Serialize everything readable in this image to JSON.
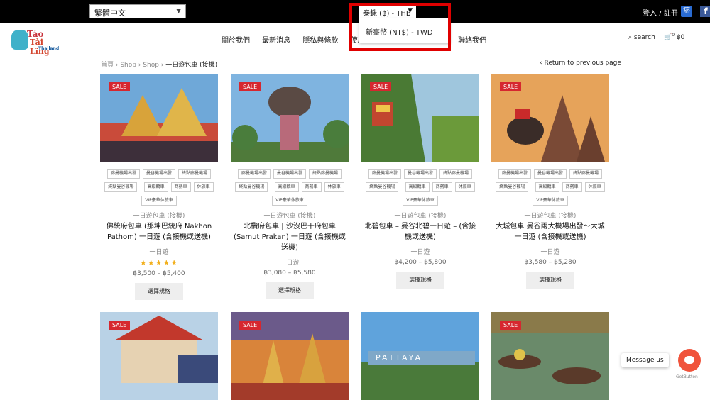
{
  "topbar": {
    "language": "繁體中文",
    "currency_selected": "泰銖 (฿) - THB",
    "currency_option": "新臺幣 (NT$) - TWD",
    "login": "登入 / 註冊",
    "pin_label": "痞",
    "fb_label": "f"
  },
  "logo": {
    "line1": "Táo",
    "line2": "Tài Lĩng",
    "line3": "Thailand"
  },
  "nav": {
    "items": [
      "關於我們",
      "最新消息",
      "隱私與條款",
      "使用條款",
      "常見問題",
      "服務",
      "聯絡我們"
    ],
    "search_label": "search",
    "cart_count": "0",
    "cart_total": "฿0"
  },
  "breadcrumb": {
    "items": [
      "首頁",
      "Shop",
      "Shop"
    ],
    "current": "一日遊包車 (接機)",
    "return_label": "Return to previous page"
  },
  "products": [
    {
      "sale": "SALE",
      "tags": [
        "廊曼機場出發",
        "曼谷機場出發",
        "終點廊曼機場",
        "終點曼谷機場",
        "高級轎車",
        "商務車",
        "休旅車",
        "VIP豪華休旅車"
      ],
      "category": "一日遊包車 (接機)",
      "title": "佛統府包車 (那坤巴統府 Nakhon Pathom) 一日遊 (含接機或送機)",
      "subtitle": "一日遊",
      "stars": "★★★★★",
      "price": "฿3,500 – ฿5,400",
      "button": "選擇規格"
    },
    {
      "sale": "SALE",
      "tags": [
        "廊曼機場出發",
        "曼谷機場出發",
        "終點廊曼機場",
        "終點曼谷機場",
        "高級轎車",
        "商務車",
        "休旅車",
        "VIP豪華休旅車"
      ],
      "category": "一日遊包車 (接機)",
      "title": "北欖府包車 | 沙沒巴干府包車 (Samut Prakan) 一日遊 (含接機或送機)",
      "subtitle": "一日遊",
      "stars": "",
      "price": "฿3,080 – ฿5,580",
      "button": "選擇規格"
    },
    {
      "sale": "SALE",
      "tags": [
        "廊曼機場出發",
        "曼谷機場出發",
        "終點廊曼機場",
        "終點曼谷機場",
        "高級轎車",
        "商務車",
        "休旅車",
        "VIP豪華休旅車"
      ],
      "category": "一日遊包車 (接機)",
      "title": "北碧包車 – 曼谷北碧一日遊 – (含接機或送機)",
      "subtitle": "一日遊",
      "stars": "",
      "price": "฿4,200 – ฿5,800",
      "button": "選擇規格"
    },
    {
      "sale": "SALE",
      "tags": [
        "廊曼機場出發",
        "曼谷機場出發",
        "終點廊曼機場",
        "終點曼谷機場",
        "高級轎車",
        "商務車",
        "休旅車",
        "VIP豪華休旅車"
      ],
      "category": "一日遊包車 (接機)",
      "title": "大城包車 曼谷兩大機場出發～大城一日遊 (含接機或送機)",
      "subtitle": "一日遊",
      "stars": "",
      "price": "฿3,580 – ฿5,280",
      "button": "選擇規格"
    }
  ],
  "row2": [
    {
      "sale": "SALE"
    },
    {
      "sale": "SALE"
    },
    {
      "sign": "PATTAYA"
    },
    {
      "sale": "SALE"
    }
  ],
  "chat": {
    "message": "Message us",
    "getbutton": "GetButton"
  }
}
